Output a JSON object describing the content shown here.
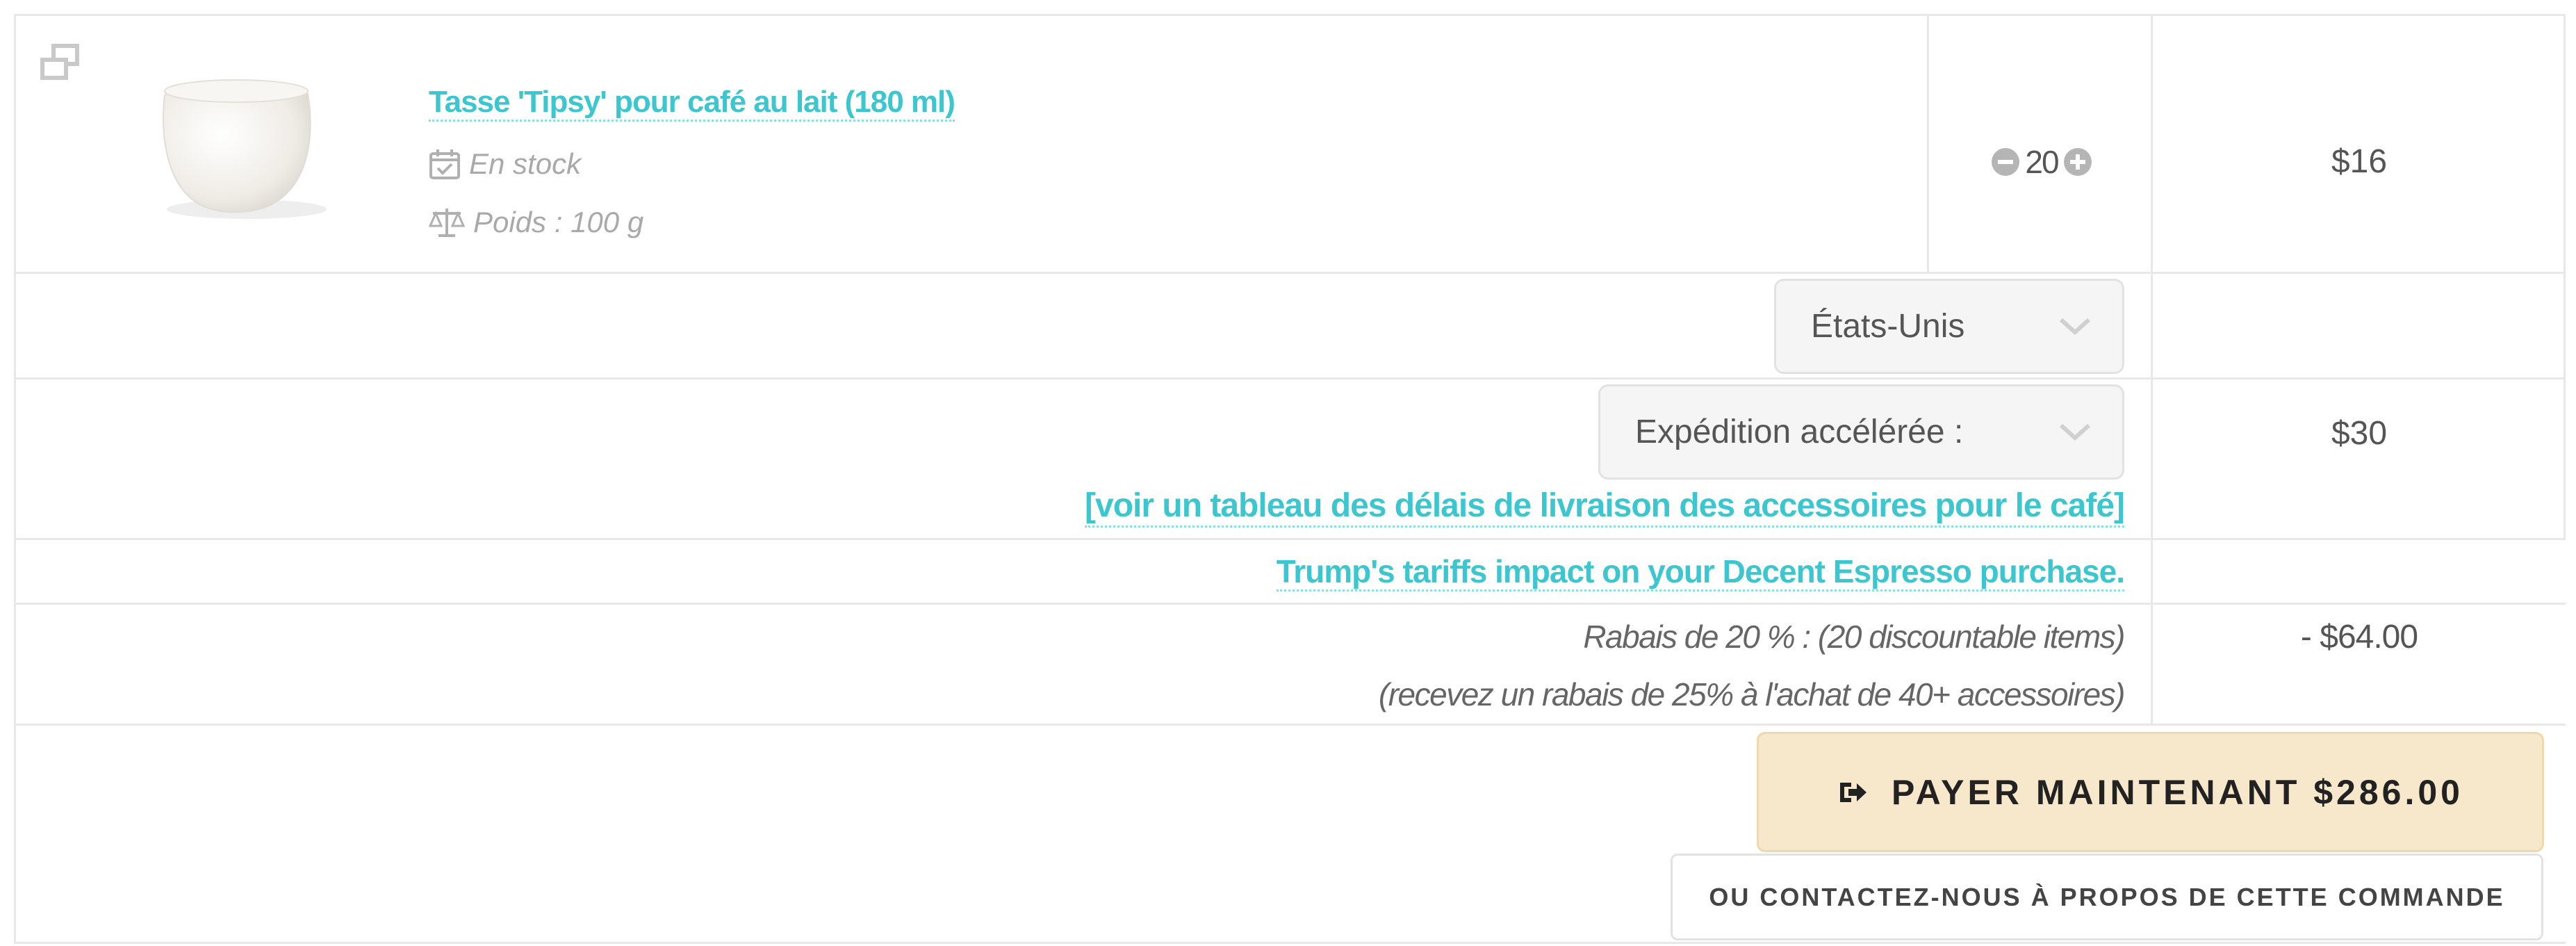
{
  "product": {
    "name": "Tasse 'Tipsy' pour café au lait (180 ml)",
    "stock": "En stock",
    "weight": "Poids : 100 g",
    "image_icon": "white-cup-image"
  },
  "quantity": {
    "value": "20",
    "minus_icon": "minus-circle-icon",
    "plus_icon": "plus-circle-icon"
  },
  "price": "$16",
  "country_select": {
    "value": "États-Unis"
  },
  "shipping_select": {
    "value": "Expédition accélérée :"
  },
  "shipping_price": "$30",
  "delivery_link": "[voir un tableau des délais de livraison des accessoires pour le café]",
  "tariffs_link": "Trump's tariffs impact on your Decent Espresso purchase.",
  "discount": {
    "line1": "Rabais de 20 % : (20 discountable items)",
    "line2": "(recevez un rabais de 25% à l'achat de 40+ accessoires)",
    "amount": "- $64.00"
  },
  "pay_button": "PAYER MAINTENANT $286.00",
  "contact_button": "OU CONTACTEZ-NOUS À PROPOS DE CETTE COMMANDE",
  "colors": {
    "link": "#3cc6cf",
    "pay_bg": "#f7e8cc",
    "border": "#e8e8e8"
  }
}
